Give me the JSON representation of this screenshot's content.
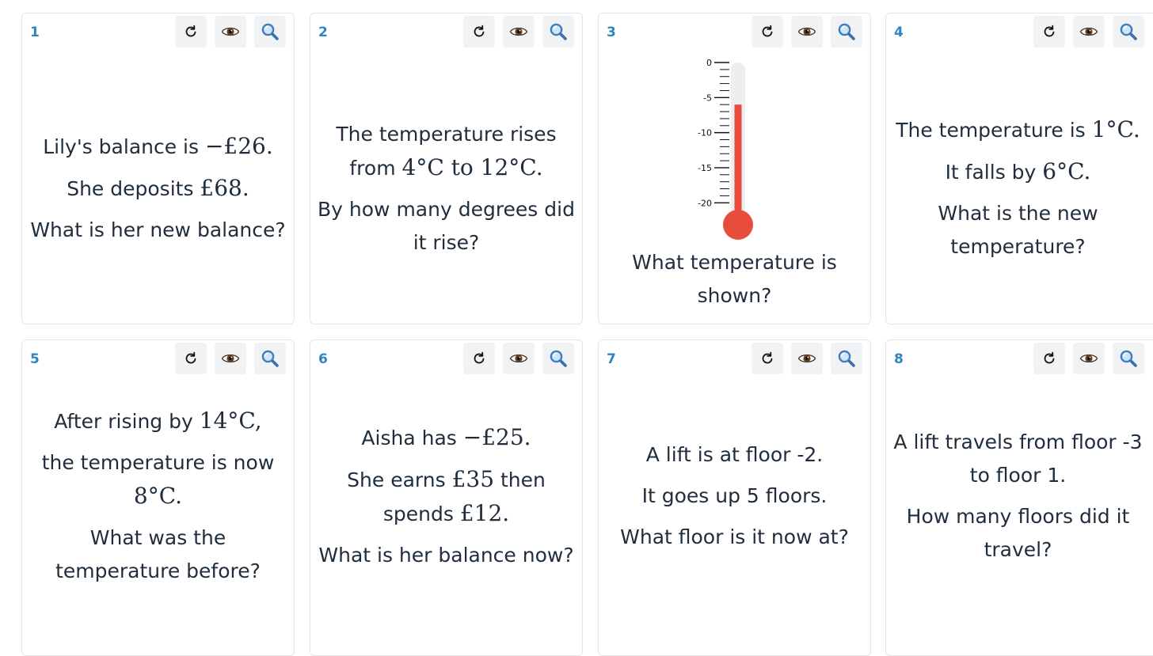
{
  "icons": {
    "refresh": "refresh-icon",
    "eye": "eye-icon",
    "magnifier": "magnifier-icon"
  },
  "colors": {
    "number": "#2e86c1",
    "text": "#1f2d3d",
    "mercury": "#e74c3c",
    "tube": "#eeeeee"
  },
  "cards": [
    {
      "number": "1",
      "lines": [
        [
          {
            "t": "text",
            "v": "Lily's balance is "
          },
          {
            "t": "math",
            "v": "−£26."
          }
        ],
        [
          {
            "t": "text",
            "v": "She deposits "
          },
          {
            "t": "math",
            "v": "£68."
          }
        ],
        [
          {
            "t": "text",
            "v": "What is her new balance?"
          }
        ]
      ]
    },
    {
      "number": "2",
      "lines": [
        [
          {
            "t": "text",
            "v": "The temperature rises from "
          },
          {
            "t": "math",
            "v": "4°C to 12°C."
          }
        ],
        [
          {
            "t": "text",
            "v": "By how many degrees did it rise?"
          }
        ]
      ]
    },
    {
      "number": "3",
      "thermometer": {
        "ticks": [
          "0",
          "-5",
          "-10",
          "-15",
          "-20"
        ],
        "reading": -6,
        "min": -22,
        "max": 0
      },
      "lines": [
        [
          {
            "t": "text",
            "v": "What temperature is shown?"
          }
        ]
      ]
    },
    {
      "number": "4",
      "lines": [
        [
          {
            "t": "text",
            "v": "The temperature is "
          },
          {
            "t": "math",
            "v": "1°C."
          }
        ],
        [
          {
            "t": "text",
            "v": "It falls by "
          },
          {
            "t": "math",
            "v": "6°C."
          }
        ],
        [
          {
            "t": "text",
            "v": "What is the new temperature?"
          }
        ]
      ]
    },
    {
      "number": "5",
      "lines": [
        [
          {
            "t": "text",
            "v": "After rising by "
          },
          {
            "t": "math",
            "v": "14°C,"
          }
        ],
        [
          {
            "t": "text",
            "v": "the temperature is now "
          },
          {
            "t": "math",
            "v": "8°C."
          }
        ],
        [
          {
            "t": "text",
            "v": "What was the temperature before?"
          }
        ]
      ]
    },
    {
      "number": "6",
      "lines": [
        [
          {
            "t": "text",
            "v": "Aisha has "
          },
          {
            "t": "math",
            "v": "−£25."
          }
        ],
        [
          {
            "t": "text",
            "v": "She earns "
          },
          {
            "t": "math",
            "v": "£35"
          },
          {
            "t": "text",
            "v": " then spends "
          },
          {
            "t": "math",
            "v": "£12."
          }
        ],
        [
          {
            "t": "text",
            "v": "What is her balance now?"
          }
        ]
      ]
    },
    {
      "number": "7",
      "lines": [
        [
          {
            "t": "text",
            "v": "A lift is at floor -2."
          }
        ],
        [
          {
            "t": "text",
            "v": "It goes up 5 floors."
          }
        ],
        [
          {
            "t": "text",
            "v": "What floor is it now at?"
          }
        ]
      ]
    },
    {
      "number": "8",
      "lines": [
        [
          {
            "t": "text",
            "v": "A lift travels from floor -3 to floor 1."
          }
        ],
        [
          {
            "t": "text",
            "v": "How many floors did it travel?"
          }
        ]
      ]
    }
  ]
}
